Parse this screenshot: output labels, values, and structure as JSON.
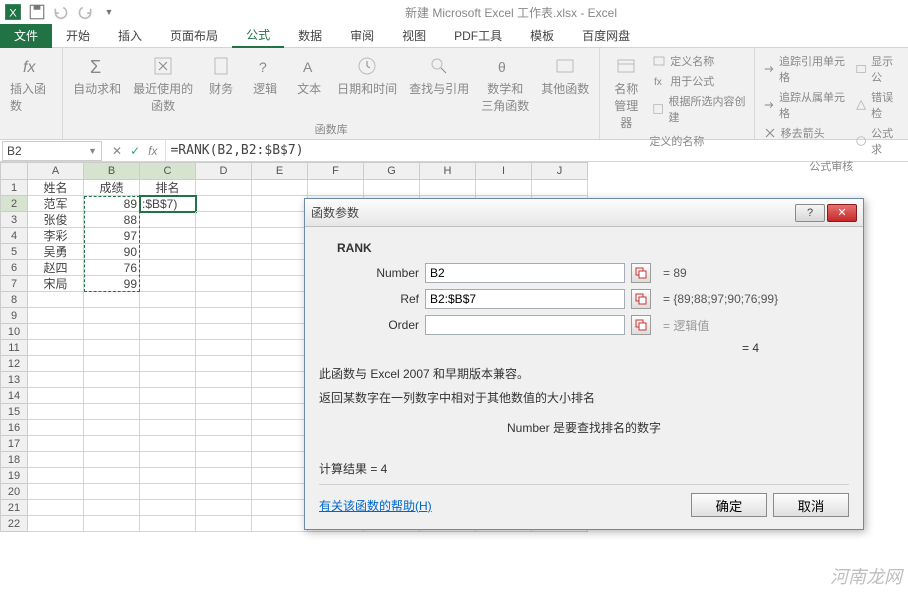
{
  "app": {
    "title": "新建 Microsoft Excel 工作表.xlsx - Excel"
  },
  "tabs": {
    "file": "文件",
    "items": [
      "开始",
      "插入",
      "页面布局",
      "公式",
      "数据",
      "审阅",
      "视图",
      "PDF工具",
      "模板",
      "百度网盘"
    ],
    "active_index": 3
  },
  "ribbon": {
    "insert_fn": "插入函数",
    "autosum": "自动求和",
    "recent": "最近使用的\n函数",
    "financial": "财务",
    "logical": "逻辑",
    "text": "文本",
    "datetime": "日期和时间",
    "lookup": "查找与引用",
    "math": "数学和\n三角函数",
    "more": "其他函数",
    "group1_label": "函数库",
    "name_mgr": "名称\n管理器",
    "define_name": "定义名称",
    "use_in_formula": "用于公式",
    "create_from_sel": "根据所选内容创建",
    "group2_label": "定义的名称",
    "trace_prec": "追踪引用单元格",
    "trace_dep": "追踪从属单元格",
    "remove_arrows": "移去箭头",
    "show_formulas": "显示公",
    "error_check": "错误检",
    "eval_formula": "公式求",
    "group3_label": "公式审核"
  },
  "fbar": {
    "namebox": "B2",
    "cancel": "✕",
    "confirm": "✓",
    "fx": "fx",
    "formula": "=RANK(B2,B2:$B$7)"
  },
  "grid": {
    "cols": [
      "A",
      "B",
      "C",
      "D",
      "E",
      "F",
      "G",
      "H",
      "I",
      "J"
    ],
    "rows": 22,
    "sel_row": 2,
    "sel_cols": [
      2,
      3
    ],
    "headers": {
      "A": "姓名",
      "B": "成绩",
      "C": "排名"
    },
    "data": [
      {
        "A": "范军",
        "B": "89",
        "C": ":$B$7)"
      },
      {
        "A": "张俊",
        "B": "88"
      },
      {
        "A": "李彩",
        "B": "97"
      },
      {
        "A": "吴勇",
        "B": "90"
      },
      {
        "A": "赵四",
        "B": "76"
      },
      {
        "A": "宋局",
        "B": "99"
      }
    ]
  },
  "dialog": {
    "title": "函数参数",
    "fn": "RANK",
    "params": [
      {
        "label": "Number",
        "value": "B2",
        "preview": "= 89"
      },
      {
        "label": "Ref",
        "value": "B2:$B$7",
        "preview": "= {89;88;97;90;76;99}"
      },
      {
        "label": "Order",
        "value": "",
        "preview": "= 逻辑值",
        "gray": true
      }
    ],
    "result_line": "= 4",
    "desc1": "此函数与 Excel 2007 和早期版本兼容。",
    "desc2": "返回某数字在一列数字中相对于其他数值的大小排名",
    "desc_param": "Number  是要查找排名的数字",
    "calc_result_label": "计算结果 = 4",
    "help": "有关该函数的帮助(H)",
    "ok": "确定",
    "cancel": "取消"
  },
  "watermark": "河南龙网"
}
